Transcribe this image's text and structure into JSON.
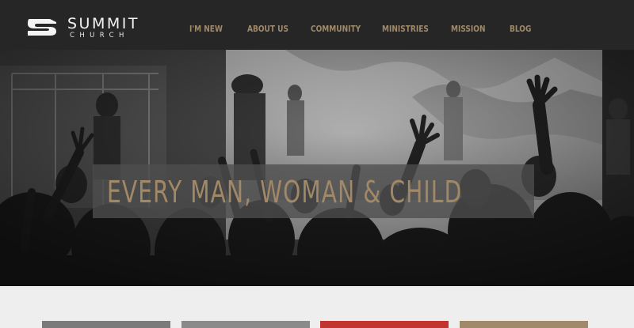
{
  "brand": {
    "name": "SUMMIT",
    "sub": "CHURCH"
  },
  "nav": [
    {
      "label": "I'M NEW"
    },
    {
      "label": "ABOUT US"
    },
    {
      "label": "COMMUNITY"
    },
    {
      "label": "MINISTRIES"
    },
    {
      "label": "MISSION"
    },
    {
      "label": "BLOG"
    }
  ],
  "hero": {
    "tagline": "EVERY MAN, WOMAN & CHILD"
  },
  "cards": [
    {
      "color": "#7a7a7a"
    },
    {
      "color": "#8a8a8a"
    },
    {
      "color": "#c2342f"
    },
    {
      "color": "#a08a6a"
    }
  ],
  "colors": {
    "header_bg": "#262626",
    "nav_text": "#a08a6a",
    "tagline_text": "#a18866",
    "lower_bg": "#eeeeee"
  }
}
